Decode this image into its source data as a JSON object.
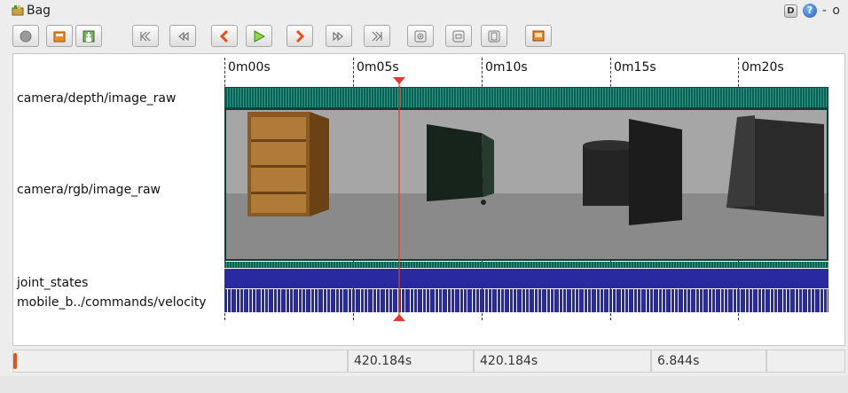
{
  "window": {
    "title": "Bag",
    "help_label": "D",
    "help_q": "?",
    "controls": "- o"
  },
  "toolbar": {
    "buttons": [
      "record-button",
      "load-bag-button",
      "save-bag-button",
      "begin-button",
      "slower-button",
      "step-back-button",
      "play-button",
      "step-forward-button",
      "faster-button",
      "end-button",
      "zoom-in-button",
      "zoom-out-button",
      "zoom-fit-button",
      "thumbnails-button"
    ]
  },
  "timeline": {
    "ticks": [
      "0m00s",
      "0m05s",
      "0m10s",
      "0m15s",
      "0m20s"
    ],
    "playhead_time_fraction": 0.29
  },
  "topics": [
    {
      "name": "camera/depth/image_raw",
      "color": "#0d6b5e"
    },
    {
      "name": "camera/rgb/image_raw",
      "color": "#0d6b5e"
    },
    {
      "name": "joint_states",
      "color": "#2a2aa0"
    },
    {
      "name": "mobile_b../commands/velocity",
      "color": "#2a2aa0"
    }
  ],
  "status": {
    "progress_fraction": 0.0,
    "start_time": "420.184s",
    "current_time": "420.184s",
    "duration": "6.844s"
  },
  "colors": {
    "playhead": "#e33b2e",
    "depth_bar": "#0d6b5e",
    "joint_bar": "#2a2aa0"
  }
}
